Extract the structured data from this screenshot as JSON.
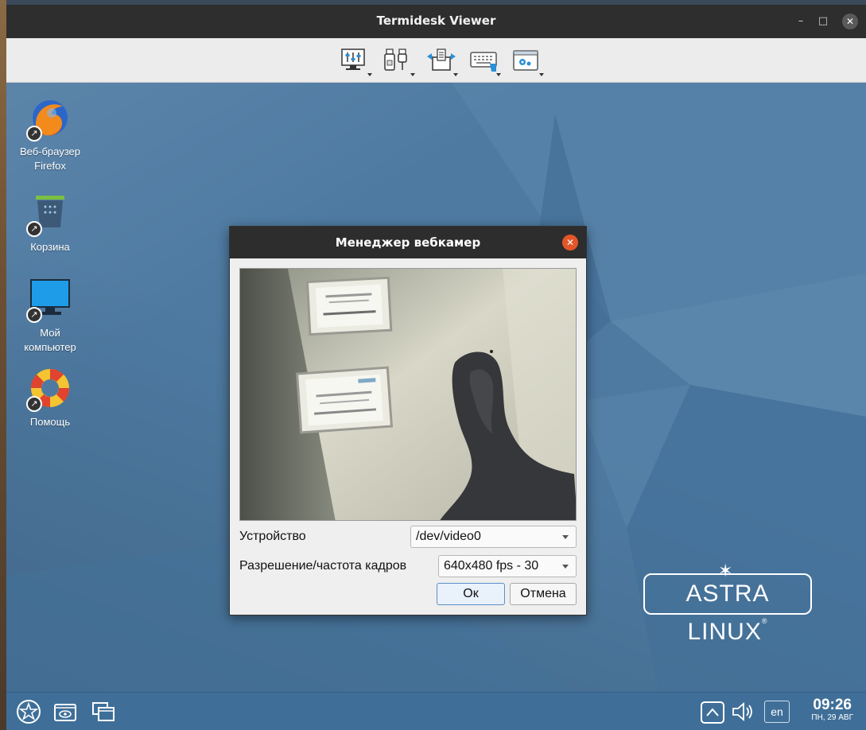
{
  "window": {
    "title": "Termidesk Viewer",
    "minimize": "–",
    "maximize": "□",
    "close": "✕"
  },
  "toolbar": {
    "items": [
      {
        "name": "display-settings",
        "icon": "monitor-sliders-icon"
      },
      {
        "name": "usb-devices",
        "icon": "usb-icon"
      },
      {
        "name": "clipboard-transfer",
        "icon": "clipboard-arrows-icon"
      },
      {
        "name": "keyboard",
        "icon": "keyboard-icon"
      },
      {
        "name": "settings",
        "icon": "window-gear-icon"
      }
    ]
  },
  "desktop": {
    "icons": [
      {
        "label_line1": "Веб-браузер",
        "label_line2": "Firefox",
        "icon": "firefox-icon"
      },
      {
        "label_line1": "Корзина",
        "label_line2": "",
        "icon": "trash-icon"
      },
      {
        "label_line1": "Мой",
        "label_line2": "компьютер",
        "icon": "computer-icon"
      },
      {
        "label_line1": "Помощь",
        "label_line2": "",
        "icon": "lifebuoy-icon"
      }
    ],
    "shortcut_badge": "↗"
  },
  "logo": {
    "text": "ASTRA LINUX",
    "reg": "®",
    "star": "✶"
  },
  "dialog": {
    "title": "Менеджер вебкамер",
    "close": "✕",
    "device_label": "Устройство",
    "device_value": "/dev/video0",
    "resolution_label": "Разрешение/частота кадров",
    "resolution_value": "640x480 fps - 30",
    "ok_label": "Ок",
    "cancel_label": "Отмена"
  },
  "taskbar": {
    "lang": "en",
    "time": "09:26",
    "date": "ПН, 29 АВГ"
  },
  "colors": {
    "desktop": "#4e7aa2",
    "titlebar": "#2e2e2e",
    "accent_close": "#e2562a",
    "taskbar": "#3f6f98"
  }
}
